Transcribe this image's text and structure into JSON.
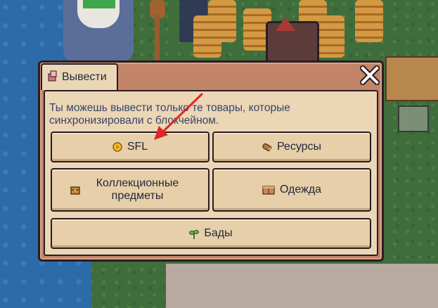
{
  "modal": {
    "tab": {
      "label": "Вывести",
      "icon": "withdraw-icon"
    },
    "close_icon": "close-icon",
    "description": "Ты можешь вывести только те товары, которые синхронизировали с блокчейном.",
    "buttons": {
      "sfl": {
        "label": "SFL",
        "icon": "sfl-coin-icon"
      },
      "resources": {
        "label": "Ресурсы",
        "icon": "wood-log-icon"
      },
      "collectibles": {
        "label": "Коллекционные предметы",
        "icon": "treasure-chest-icon"
      },
      "wearables": {
        "label": "Одежда",
        "icon": "wardrobe-icon"
      },
      "buds": {
        "label": "Бады",
        "icon": "sprout-icon"
      }
    }
  },
  "colors": {
    "frame": "#c28569",
    "panel": "#ebd6b6",
    "button": "#e6cfa9",
    "outline": "#2b1c22",
    "text": "#3a4466",
    "annotation_arrow": "#e02626"
  }
}
